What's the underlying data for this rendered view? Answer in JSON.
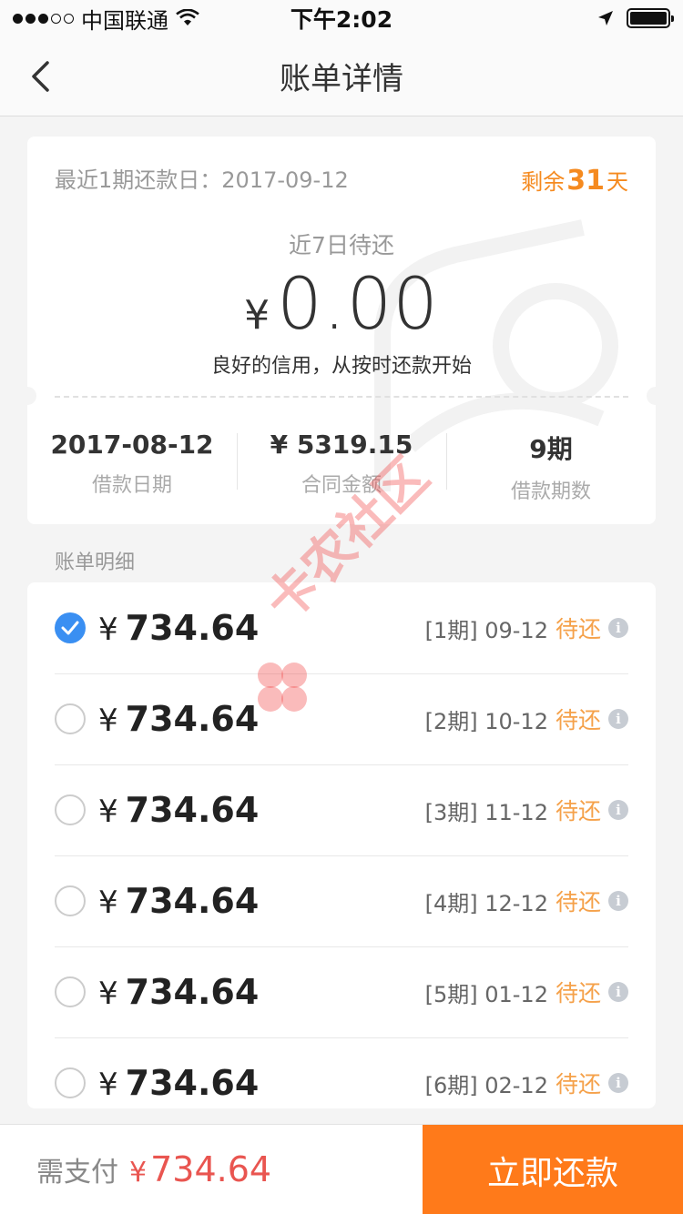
{
  "status_bar": {
    "carrier": "中国联通",
    "time": "下午2:02"
  },
  "nav": {
    "title": "账单详情"
  },
  "summary": {
    "recent_due_label": "最近1期还款日：",
    "recent_due_date": "2017-09-12",
    "remain_prefix": "剩余",
    "remain_days": "31",
    "remain_suffix": "天",
    "seven_day_label": "近7日待还",
    "currency": "¥",
    "amount": "0.00",
    "credit_tip": "良好的信用，从按时还款开始",
    "stats": [
      {
        "value": "2017-08-12",
        "label": "借款日期"
      },
      {
        "value": "¥ 5319.15",
        "label": "合同金额"
      },
      {
        "value": "9期",
        "label": "借款期数"
      }
    ]
  },
  "section_label": "账单明细",
  "bills": [
    {
      "currency": "¥",
      "amount": "734.64",
      "period": "[1期] 09-12",
      "status": "待还",
      "checked": true
    },
    {
      "currency": "¥",
      "amount": "734.64",
      "period": "[2期] 10-12",
      "status": "待还",
      "checked": false
    },
    {
      "currency": "¥",
      "amount": "734.64",
      "period": "[3期] 11-12",
      "status": "待还",
      "checked": false
    },
    {
      "currency": "¥",
      "amount": "734.64",
      "period": "[4期] 12-12",
      "status": "待还",
      "checked": false
    },
    {
      "currency": "¥",
      "amount": "734.64",
      "period": "[5期] 01-12",
      "status": "待还",
      "checked": false
    },
    {
      "currency": "¥",
      "amount": "734.64",
      "period": "[6期] 02-12",
      "status": "待还",
      "checked": false
    }
  ],
  "watermark": "卡农社区",
  "bottom": {
    "pay_label": "需支付",
    "pay_currency": "¥",
    "pay_amount": "734.64",
    "repay_button": "立即还款"
  },
  "colors": {
    "accent_orange": "#ff7a1a",
    "status_orange": "#f5a14a",
    "check_blue": "#3a8ff2",
    "price_red": "#e95550"
  }
}
